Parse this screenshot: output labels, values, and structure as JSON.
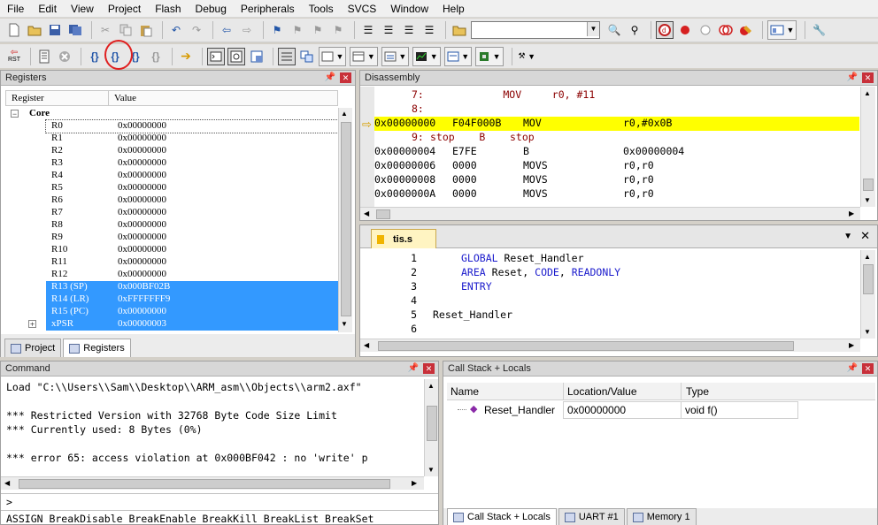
{
  "menu": [
    "File",
    "Edit",
    "View",
    "Project",
    "Flash",
    "Debug",
    "Peripherals",
    "Tools",
    "SVCS",
    "Window",
    "Help"
  ],
  "toolbar": {
    "rst_label": "RST",
    "step_into_label": "{}",
    "step_over_label": "{}",
    "step_out_label": "{}",
    "run_to_cursor_label": "{}"
  },
  "registers": {
    "title": "Registers",
    "col_register": "Register",
    "col_value": "Value",
    "group": "Core",
    "rows": [
      {
        "name": "R0",
        "value": "0x00000000"
      },
      {
        "name": "R1",
        "value": "0x00000000"
      },
      {
        "name": "R2",
        "value": "0x00000000"
      },
      {
        "name": "R3",
        "value": "0x00000000"
      },
      {
        "name": "R4",
        "value": "0x00000000"
      },
      {
        "name": "R5",
        "value": "0x00000000"
      },
      {
        "name": "R6",
        "value": "0x00000000"
      },
      {
        "name": "R7",
        "value": "0x00000000"
      },
      {
        "name": "R8",
        "value": "0x00000000"
      },
      {
        "name": "R9",
        "value": "0x00000000"
      },
      {
        "name": "R10",
        "value": "0x00000000"
      },
      {
        "name": "R11",
        "value": "0x00000000"
      },
      {
        "name": "R12",
        "value": "0x00000000"
      },
      {
        "name": "R13 (SP)",
        "value": "0x000BF02B"
      },
      {
        "name": "R14 (LR)",
        "value": "0xFFFFFFF9"
      },
      {
        "name": "R15 (PC)",
        "value": "0x00000000"
      },
      {
        "name": "xPSR",
        "value": "0x00000003"
      }
    ],
    "tab_project": "Project",
    "tab_registers": "Registers"
  },
  "disassembly": {
    "title": "Disassembly",
    "lines": [
      {
        "num": "7:",
        "text": "        MOV     r0, #11"
      },
      {
        "num": "8:",
        "text": ""
      },
      {
        "addr": "0x00000000",
        "op": "F04F000B",
        "mn": "MOV",
        "args": "r0,#0x0B"
      },
      {
        "num": "9:",
        "text": "stop    B    stop"
      },
      {
        "addr": "0x00000004",
        "op": "E7FE",
        "mn": "B",
        "args": "0x00000004"
      },
      {
        "addr": "0x00000006",
        "op": "0000",
        "mn": "MOVS",
        "args": "r0,r0"
      },
      {
        "addr": "0x00000008",
        "op": "0000",
        "mn": "MOVS",
        "args": "r0,r0"
      },
      {
        "addr": "0x0000000A",
        "op": "0000",
        "mn": "MOVS",
        "args": "r0,r0"
      }
    ]
  },
  "source": {
    "tab": "tis.s",
    "lines": [
      {
        "n": "1",
        "code": "GLOBAL Reset_Handler"
      },
      {
        "n": "2",
        "code": "AREA Reset, CODE, READONLY"
      },
      {
        "n": "3",
        "code": "ENTRY"
      },
      {
        "n": "4",
        "code": ""
      },
      {
        "n": "5",
        "code": "Reset_Handler"
      },
      {
        "n": "6",
        "code": ""
      }
    ]
  },
  "command": {
    "title": "Command",
    "lines": [
      "Load \"C:\\\\Users\\\\Sam\\\\Desktop\\\\ARM_asm\\\\Objects\\\\arm2.axf\"",
      "",
      "*** Restricted Version with 32768 Byte Code Size Limit",
      "*** Currently used: 8 Bytes (0%)",
      "",
      "*** error 65: access violation at 0x000BF042 : no 'write' p"
    ],
    "prompt": ">",
    "hint": "ASSIGN BreakDisable BreakEnable BreakKill BreakList BreakSet"
  },
  "callstack": {
    "title": "Call Stack + Locals",
    "col_name": "Name",
    "col_location": "Location/Value",
    "col_type": "Type",
    "row": {
      "name": "Reset_Handler",
      "location": "0x00000000",
      "type": "void f()"
    },
    "tabs": [
      "Call Stack + Locals",
      "UART #1",
      "Memory 1"
    ]
  },
  "colors": {
    "highlight": "#ffff00",
    "selection": "#3399ff",
    "keyword": "#1a1acc",
    "line_numbers": "#8b0000"
  }
}
